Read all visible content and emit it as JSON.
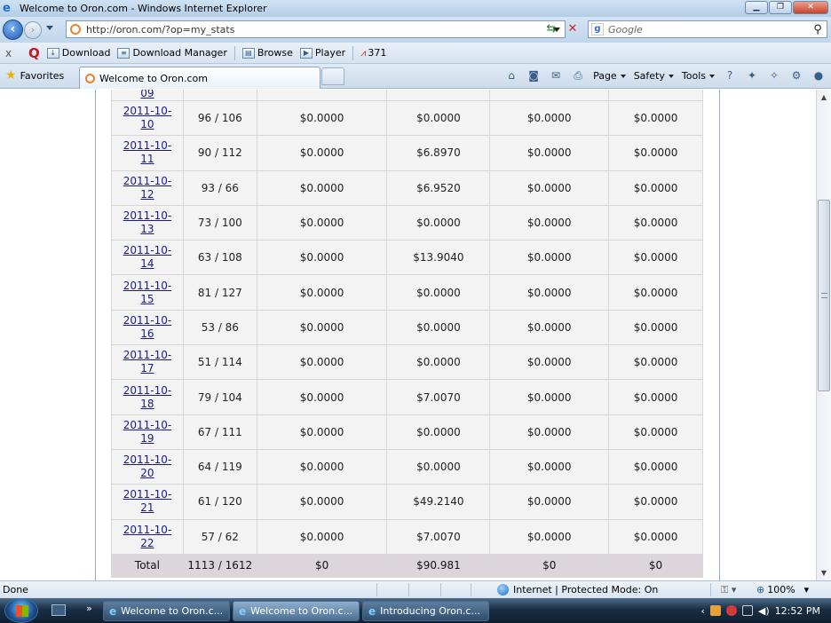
{
  "window": {
    "title": "Welcome to Oron.com - Windows Internet Explorer",
    "btn_min": "▁",
    "btn_max": "❐",
    "btn_close": "✕"
  },
  "address": {
    "url": "http://oron.com/?op=my_stats",
    "search_placeholder": "Google",
    "icons": [
      "back-icon",
      "forward-icon",
      "refresh-icon",
      "stop-icon",
      "search-icon"
    ]
  },
  "toolbar": {
    "close_label": "x",
    "items": [
      {
        "label": "Download"
      },
      {
        "label": "Download Manager"
      },
      {
        "label": "Browse"
      },
      {
        "label": "Player"
      },
      {
        "label": "371"
      }
    ]
  },
  "favbar": {
    "favorites_label": "Favorites",
    "tab_label": "Welcome to Oron.com",
    "commands": [
      {
        "label": "Page"
      },
      {
        "label": "Safety"
      },
      {
        "label": "Tools"
      }
    ]
  },
  "stats": {
    "partial_row_date": "09",
    "rows": [
      {
        "date_a": "2011-10-",
        "date_b": "10",
        "downloads": "96 / 106",
        "c3": "$0.0000",
        "c4": "$0.0000",
        "c5": "$0.0000",
        "c6": "$0.0000"
      },
      {
        "date_a": "2011-10-",
        "date_b": "11",
        "downloads": "90 / 112",
        "c3": "$0.0000",
        "c4": "$6.8970",
        "c5": "$0.0000",
        "c6": "$0.0000"
      },
      {
        "date_a": "2011-10-",
        "date_b": "12",
        "downloads": "93 / 66",
        "c3": "$0.0000",
        "c4": "$6.9520",
        "c5": "$0.0000",
        "c6": "$0.0000"
      },
      {
        "date_a": "2011-10-",
        "date_b": "13",
        "downloads": "73 / 100",
        "c3": "$0.0000",
        "c4": "$0.0000",
        "c5": "$0.0000",
        "c6": "$0.0000"
      },
      {
        "date_a": "2011-10-",
        "date_b": "14",
        "downloads": "63 / 108",
        "c3": "$0.0000",
        "c4": "$13.9040",
        "c5": "$0.0000",
        "c6": "$0.0000"
      },
      {
        "date_a": "2011-10-",
        "date_b": "15",
        "downloads": "81 / 127",
        "c3": "$0.0000",
        "c4": "$0.0000",
        "c5": "$0.0000",
        "c6": "$0.0000"
      },
      {
        "date_a": "2011-10-",
        "date_b": "16",
        "downloads": "53 / 86",
        "c3": "$0.0000",
        "c4": "$0.0000",
        "c5": "$0.0000",
        "c6": "$0.0000"
      },
      {
        "date_a": "2011-10-",
        "date_b": "17",
        "downloads": "51 / 114",
        "c3": "$0.0000",
        "c4": "$0.0000",
        "c5": "$0.0000",
        "c6": "$0.0000"
      },
      {
        "date_a": "2011-10-",
        "date_b": "18",
        "downloads": "79 / 104",
        "c3": "$0.0000",
        "c4": "$7.0070",
        "c5": "$0.0000",
        "c6": "$0.0000"
      },
      {
        "date_a": "2011-10-",
        "date_b": "19",
        "downloads": "67 / 111",
        "c3": "$0.0000",
        "c4": "$0.0000",
        "c5": "$0.0000",
        "c6": "$0.0000"
      },
      {
        "date_a": "2011-10-",
        "date_b": "20",
        "downloads": "64 / 119",
        "c3": "$0.0000",
        "c4": "$0.0000",
        "c5": "$0.0000",
        "c6": "$0.0000"
      },
      {
        "date_a": "2011-10-",
        "date_b": "21",
        "downloads": "61 / 120",
        "c3": "$0.0000",
        "c4": "$49.2140",
        "c5": "$0.0000",
        "c6": "$0.0000"
      },
      {
        "date_a": "2011-10-",
        "date_b": "22",
        "downloads": "57 / 62",
        "c3": "$0.0000",
        "c4": "$7.0070",
        "c5": "$0.0000",
        "c6": "$0.0000"
      }
    ],
    "total": {
      "label": "Total",
      "downloads": "1113 / 1612",
      "c3": "$0",
      "c4": "$90.981",
      "c5": "$0",
      "c6": "$0"
    }
  },
  "status": {
    "text": "Done",
    "zone": "Internet | Protected Mode: On",
    "zoom": "100%"
  },
  "taskbar": {
    "more": "»",
    "buttons": [
      {
        "label": "Welcome to Oron.c..."
      },
      {
        "label": "Welcome to Oron.c..."
      },
      {
        "label": "Introducing Oron.c..."
      }
    ],
    "clock": "12:52 PM"
  }
}
